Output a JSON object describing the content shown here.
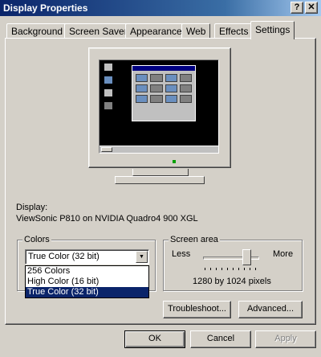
{
  "window": {
    "title": "Display Properties",
    "help_glyph": "?",
    "close_glyph": "✕"
  },
  "tabs": [
    {
      "label": "Background"
    },
    {
      "label": "Screen Saver"
    },
    {
      "label": "Appearance"
    },
    {
      "label": "Web"
    },
    {
      "label": "Effects"
    },
    {
      "label": "Settings",
      "active": true
    }
  ],
  "display": {
    "label": "Display:",
    "value": "ViewSonic P810 on NVIDIA Quadro4 900 XGL"
  },
  "colors": {
    "legend": "Colors",
    "selected": "True Color (32 bit)",
    "options": [
      "256 Colors",
      "High Color (16 bit)",
      "True Color (32 bit)"
    ]
  },
  "screen_area": {
    "legend": "Screen area",
    "less": "Less",
    "more": "More",
    "value": "1280 by 1024 pixels",
    "slider_fraction": 0.72
  },
  "buttons": {
    "troubleshoot": "Troubleshoot...",
    "advanced": "Advanced...",
    "ok": "OK",
    "cancel": "Cancel",
    "apply": "Apply"
  },
  "colors_accent": {
    "title_start": "#0a246a",
    "selection": "#0a246a",
    "led": "#00a000"
  }
}
